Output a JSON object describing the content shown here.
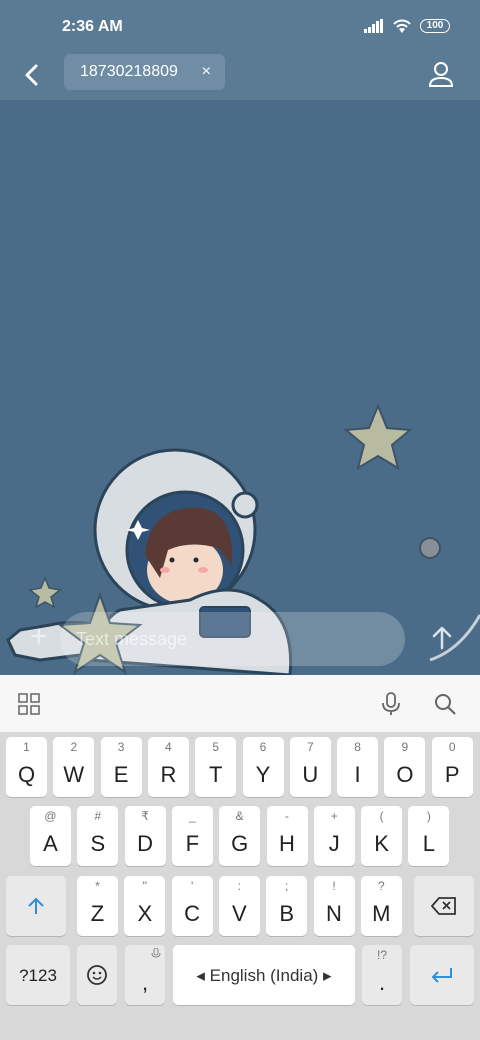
{
  "status": {
    "time": "2:36 AM",
    "battery": "100"
  },
  "header": {
    "recipient": "18730218809",
    "remove": "×"
  },
  "compose": {
    "placeholder": "Text message"
  },
  "keyboard": {
    "row1": [
      {
        "k": "Q",
        "s": "1"
      },
      {
        "k": "W",
        "s": "2"
      },
      {
        "k": "E",
        "s": "3"
      },
      {
        "k": "R",
        "s": "4"
      },
      {
        "k": "T",
        "s": "5"
      },
      {
        "k": "Y",
        "s": "6"
      },
      {
        "k": "U",
        "s": "7"
      },
      {
        "k": "I",
        "s": "8"
      },
      {
        "k": "O",
        "s": "9"
      },
      {
        "k": "P",
        "s": "0"
      }
    ],
    "row2": [
      {
        "k": "A",
        "s": "@"
      },
      {
        "k": "S",
        "s": "#"
      },
      {
        "k": "D",
        "s": "₹"
      },
      {
        "k": "F",
        "s": "_"
      },
      {
        "k": "G",
        "s": "&"
      },
      {
        "k": "H",
        "s": "-"
      },
      {
        "k": "J",
        "s": "+"
      },
      {
        "k": "K",
        "s": "("
      },
      {
        "k": "L",
        "s": ")"
      }
    ],
    "row3": [
      {
        "k": "Z",
        "s": "*"
      },
      {
        "k": "X",
        "s": "\""
      },
      {
        "k": "C",
        "s": "'"
      },
      {
        "k": "V",
        "s": ":"
      },
      {
        "k": "B",
        "s": ";"
      },
      {
        "k": "N",
        "s": "!"
      },
      {
        "k": "M",
        "s": "?"
      }
    ],
    "symbols": "?123",
    "comma": ",",
    "space": "English (India)",
    "period": ".",
    "period_sup": "!?"
  }
}
